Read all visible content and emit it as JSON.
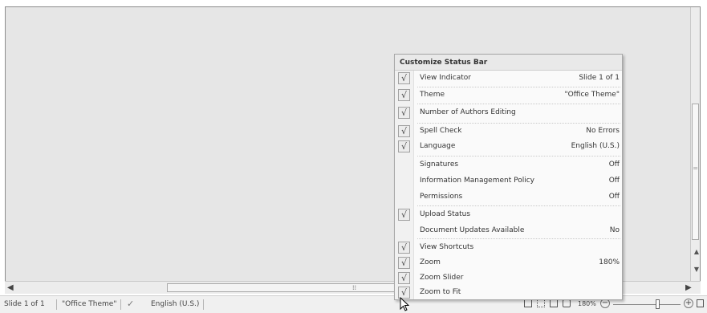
{
  "menu": {
    "title": "Customize Status Bar",
    "items": [
      {
        "label": "View Indicator",
        "value": "Slide 1 of 1",
        "checked": true
      },
      {
        "label": "Theme",
        "value": "\"Office Theme\"",
        "checked": true
      },
      {
        "label": "Number of Authors Editing",
        "value": "",
        "checked": true
      },
      {
        "label": "Spell Check",
        "value": "No Errors",
        "checked": true
      },
      {
        "label": "Language",
        "value": "English (U.S.)",
        "checked": true
      },
      {
        "label": "Signatures",
        "value": "Off",
        "checked": false
      },
      {
        "label": "Information Management Policy",
        "value": "Off",
        "checked": false
      },
      {
        "label": "Permissions",
        "value": "Off",
        "checked": false
      },
      {
        "label": "Upload Status",
        "value": "",
        "checked": true
      },
      {
        "label": "Document Updates Available",
        "value": "No",
        "checked": false
      },
      {
        "label": "View Shortcuts",
        "value": "",
        "checked": true
      },
      {
        "label": "Zoom",
        "value": "180%",
        "checked": true
      },
      {
        "label": "Zoom Slider",
        "value": "",
        "checked": true
      },
      {
        "label": "Zoom to Fit",
        "value": "",
        "checked": true
      }
    ]
  },
  "status_bar": {
    "slide_indicator": "Slide 1 of 1",
    "theme": "\"Office Theme\"",
    "language": "English (U.S.)",
    "zoom": "180%",
    "zoom_minus": "−",
    "zoom_plus": "+"
  },
  "icons": {
    "check_mark": "√",
    "spell_check_icon": "✓",
    "scroll_left": "◀",
    "scroll_right": "▶",
    "scroll_grip": "⁞⁞",
    "cursor": "arrow-pointer"
  }
}
